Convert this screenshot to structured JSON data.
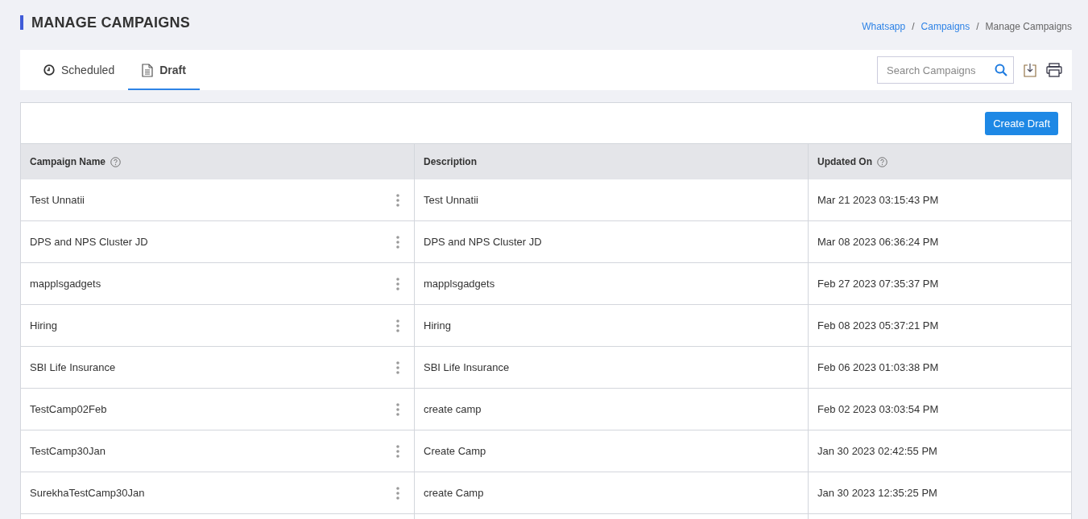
{
  "page_title": "MANAGE CAMPAIGNS",
  "breadcrumbs": [
    {
      "label": "Whatsapp",
      "link": true
    },
    {
      "label": "Campaigns",
      "link": true
    },
    {
      "label": "Manage Campaigns",
      "link": false
    }
  ],
  "breadcrumb_separator": "/",
  "tabs": [
    {
      "label": "Scheduled",
      "kind": "clock",
      "selected": false
    },
    {
      "label": "Draft",
      "kind": "document",
      "selected": true
    }
  ],
  "search": {
    "placeholder": "Search Campaigns"
  },
  "create_button": "Create Draft",
  "table": {
    "columns": [
      {
        "label": "Campaign Name",
        "help": true
      },
      {
        "label": "Description",
        "help": false
      },
      {
        "label": "Updated On",
        "help": true
      }
    ],
    "rows": [
      {
        "name": "Test Unnatii",
        "description": "Test Unnatii",
        "updated": "Mar 21 2023 03:15:43 PM"
      },
      {
        "name": "DPS and NPS Cluster JD",
        "description": "DPS and NPS Cluster JD",
        "updated": "Mar 08 2023 06:36:24 PM"
      },
      {
        "name": "mapplsgadgets",
        "description": "mapplsgadgets",
        "updated": "Feb 27 2023 07:35:37 PM"
      },
      {
        "name": "Hiring",
        "description": "Hiring",
        "updated": "Feb 08 2023 05:37:21 PM"
      },
      {
        "name": "SBI Life Insurance",
        "description": "SBI Life Insurance",
        "updated": "Feb 06 2023 01:03:38 PM"
      },
      {
        "name": "TestCamp02Feb",
        "description": "create camp",
        "updated": "Feb 02 2023 03:03:54 PM"
      },
      {
        "name": "TestCamp30Jan",
        "description": "Create Camp",
        "updated": "Jan 30 2023 02:42:55 PM"
      },
      {
        "name": "SurekhaTestCamp30Jan",
        "description": "create Camp",
        "updated": "Jan 30 2023 12:35:25 PM"
      }
    ]
  }
}
